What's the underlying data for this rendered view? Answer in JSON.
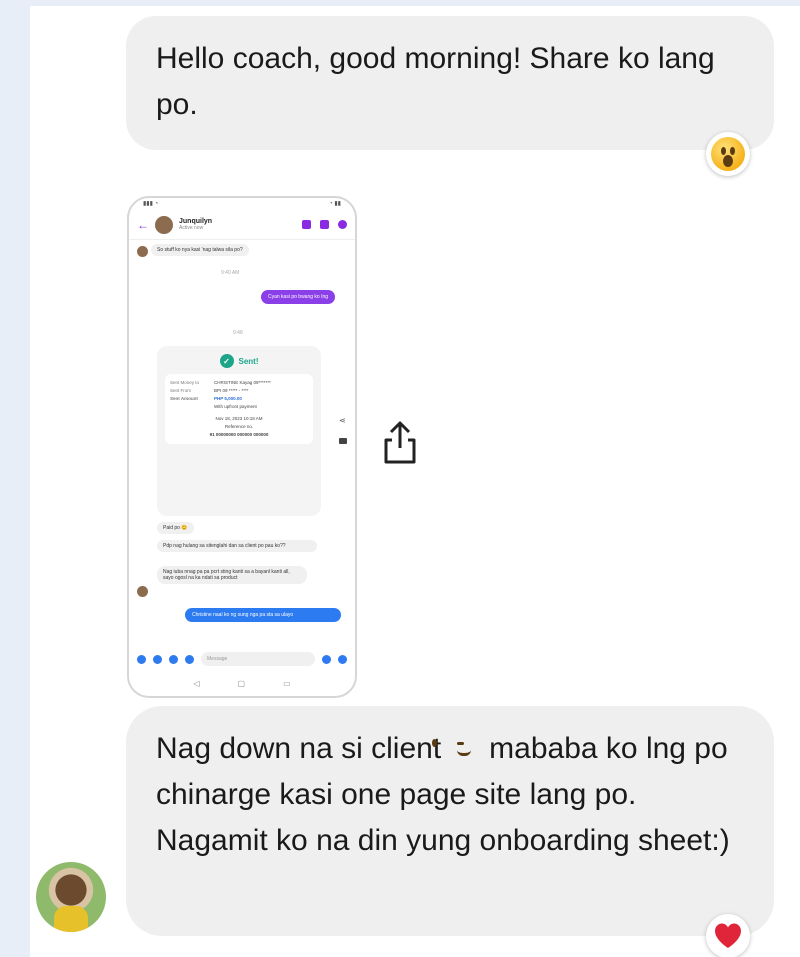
{
  "messages": {
    "first": {
      "text": "Hello coach, good morning! Share ko lang po.",
      "reaction": "astonished-face"
    },
    "attachment": {
      "type": "screenshot",
      "phone": {
        "status_time": "",
        "contact_name": "Junquilyn",
        "contact_status": "Active now",
        "top_message": "So stuff ko nya kasi 'nag talwa sila po?",
        "time_1": "9:40 AM",
        "purple_message": "Cyan kasi po bwang ko Ing",
        "time_2": "9:48",
        "card": {
          "status": "Sent!",
          "rows": [
            {
              "k": "Sent Money to",
              "v": "CHRISTINE Kayag 09*******"
            },
            {
              "k": "Sent From",
              "v": "BPI 09 ***** - ****"
            },
            {
              "k": "Sent Amount",
              "v": "PHP 5,000.00"
            },
            {
              "k": "",
              "v": "With upfront payment"
            }
          ],
          "date": "Nov 18, 2023 10:18 AM",
          "ref_label": "Reference no.",
          "ref_no": "91 00000000 000000 000000"
        },
        "gray_1": "Paid po 😊",
        "gray_2": "Pdp nag hulang sa sitenglahi dan sa client po pau ko??",
        "gray_3": "Nag iuba nnag pa pa pcrt sting kanti sa a bayanl kanti all, sayo ogosl na ka ndati sa product",
        "blue_message": "Christine naal ko ng sung nga pa sta sa ulayo",
        "input_placeholder": "Message"
      }
    },
    "second": {
      "text_before_emoji": "Nag down na si client",
      "inline_emoji": "winking-face",
      "text_after_emoji": "mababa ko lng po chinarge kasi one page site lang po. Nagamit ko na din yung onboarding sheet:)",
      "reaction": "red-heart"
    }
  },
  "colors": {
    "page_bg": "#e8eef8",
    "bubble_bg": "#efefef",
    "accent_purple": "#8b3fe8",
    "accent_blue": "#2d7bf0",
    "sent_green": "#1da58a",
    "heart": "#e0243a"
  }
}
